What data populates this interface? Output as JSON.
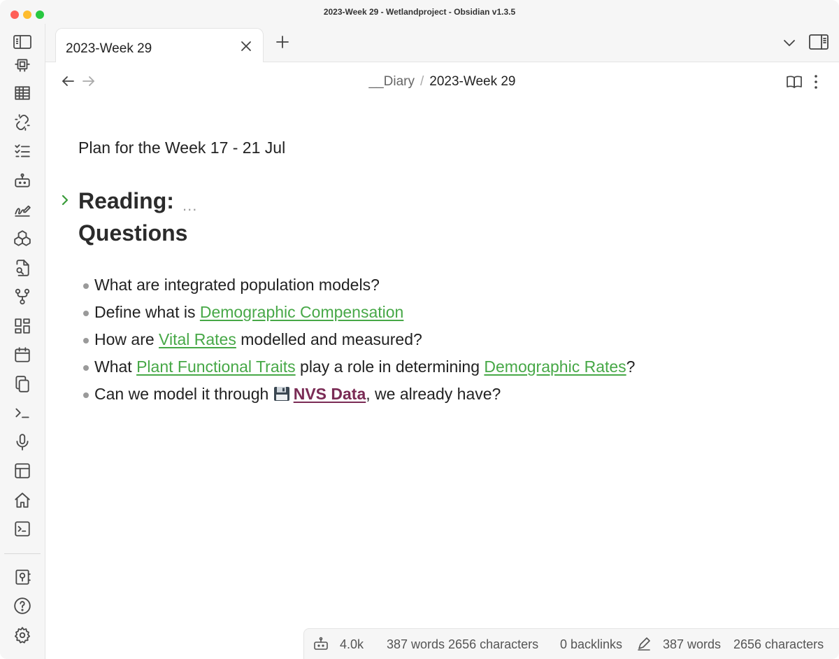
{
  "window": {
    "title": "2023-Week 29 - Wetlandproject - Obsidian v1.3.5"
  },
  "ribbon": {
    "toggle_icon": "sidebar-left-icon",
    "items": [
      {
        "icon": "chip-icon"
      },
      {
        "icon": "table-icon"
      },
      {
        "icon": "broken-link-icon"
      },
      {
        "icon": "checklist-icon"
      },
      {
        "icon": "bot-icon"
      },
      {
        "icon": "signature-icon"
      },
      {
        "icon": "boxes-icon"
      },
      {
        "icon": "file-search-icon"
      },
      {
        "icon": "git-fork-icon"
      },
      {
        "icon": "layout-dashboard-icon"
      },
      {
        "icon": "calendar-icon"
      },
      {
        "icon": "copy-icon"
      },
      {
        "icon": "terminal-icon"
      },
      {
        "icon": "microphone-icon"
      },
      {
        "icon": "layout-template-icon"
      },
      {
        "icon": "home-icon"
      },
      {
        "icon": "terminal-square-icon"
      }
    ],
    "bottom_items": [
      {
        "icon": "vault-icon"
      },
      {
        "icon": "help-icon"
      },
      {
        "icon": "settings-icon"
      }
    ]
  },
  "tabs": {
    "active_tab": "2023-Week 29"
  },
  "header": {
    "breadcrumb_folder": "__Diary",
    "breadcrumb_separator": "/",
    "breadcrumb_file": "2023-Week 29"
  },
  "note": {
    "plan_line": "Plan for the Week 17 - 21 Jul",
    "heading_reading": "Reading:",
    "heading_ellipsis": "...",
    "heading_questions": "Questions",
    "q1": "What are integrated population models?",
    "q2_pre": "Define what is ",
    "q2_link": "Demographic Compensation",
    "q3_pre": "How are ",
    "q3_link": "Vital Rates",
    "q3_post": " modelled and measured?",
    "q4_pre": "What ",
    "q4_link1": "Plant Functional Traits",
    "q4_mid": " play a role in determining ",
    "q4_link2": "Demographic Rates",
    "q4_post": "?",
    "q5_pre": "Can we model it through ",
    "q5_link": "NVS Data",
    "q5_post": ", we already have?"
  },
  "statusbar": {
    "tokens": "4.0k",
    "word_char_count": "387 words 2656 characters",
    "backlinks": "0 backlinks",
    "words": "387 words",
    "characters": "2656 characters"
  },
  "colors": {
    "accent_link": "#47a847",
    "nvs_link": "#7a2b55",
    "fold_chevron": "#3a9c3a"
  }
}
